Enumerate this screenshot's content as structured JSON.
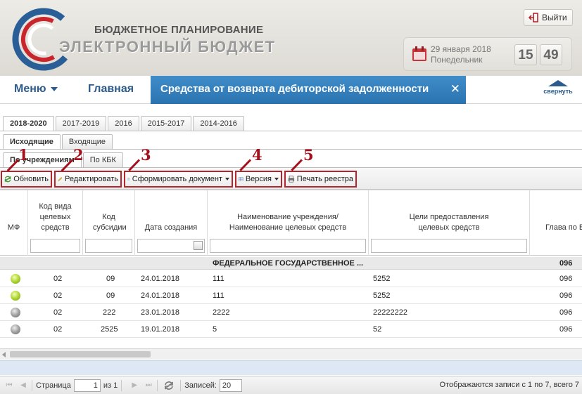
{
  "header": {
    "brand_top": "БЮДЖЕТНОЕ ПЛАНИРОВАНИЕ",
    "brand_bottom": "ЭЛЕКТРОННЫЙ БЮДЖЕТ",
    "logout_label": "Выйти",
    "date": "29 января 2018",
    "weekday": "Понедельник",
    "clock_hours": "15",
    "clock_minutes": "49"
  },
  "nav": {
    "menu_label": "Меню",
    "home_label": "Главная",
    "active_tab": "Средства от возврата дебиторской задолженности",
    "close_glyph": "✕",
    "collapse_label": "свернуть"
  },
  "year_tabs": [
    "2018-2020",
    "2017-2019",
    "2016",
    "2015-2017",
    "2014-2016"
  ],
  "direction_tabs": [
    "Исходящие",
    "Входящие"
  ],
  "group_tabs": [
    "По учреждениям",
    "По КБК"
  ],
  "toolbar": {
    "refresh": "Обновить",
    "edit": "Редактировать",
    "make_doc": "Сформировать документ",
    "version": "Версия",
    "print": "Печать реестра"
  },
  "callouts": [
    "1",
    "2",
    "3",
    "4",
    "5"
  ],
  "grid": {
    "columns": [
      "МФ",
      "Код вида целевых средств",
      "Код субсидии",
      "Дата создания",
      "Наименование учреждения/ Наименование целевых средств",
      "Цели предоставления целевых средств",
      "Глава по Б"
    ],
    "group": {
      "name": "ФЕДЕРАЛЬНОЕ ГОСУДАРСТВЕННОЕ ...",
      "chapter": "096"
    },
    "rows": [
      {
        "status": "green",
        "kind": "02",
        "subsidy": "09",
        "date": "24.01.2018",
        "name": "111",
        "goal": "5252",
        "chapter": "096"
      },
      {
        "status": "green",
        "kind": "02",
        "subsidy": "09",
        "date": "24.01.2018",
        "name": "111",
        "goal": "5252",
        "chapter": "096"
      },
      {
        "status": "gray",
        "kind": "02",
        "subsidy": "222",
        "date": "23.01.2018",
        "name": "2222",
        "goal": "22222222",
        "chapter": "096"
      },
      {
        "status": "gray",
        "kind": "02",
        "subsidy": "2525",
        "date": "19.01.2018",
        "name": "5",
        "goal": "52",
        "chapter": "096"
      }
    ]
  },
  "pager": {
    "page_label": "Страница",
    "page_value": "1",
    "of_label": "из 1",
    "records_label": "Записей:",
    "records_value": "20",
    "info": "Отображаются записи с 1 по 7, всего 7"
  },
  "colors": {
    "accent_blue": "#2a73b1",
    "highlight_red": "#b3262e",
    "status_green": "#a8d12b",
    "status_gray": "#9a9a9a"
  }
}
